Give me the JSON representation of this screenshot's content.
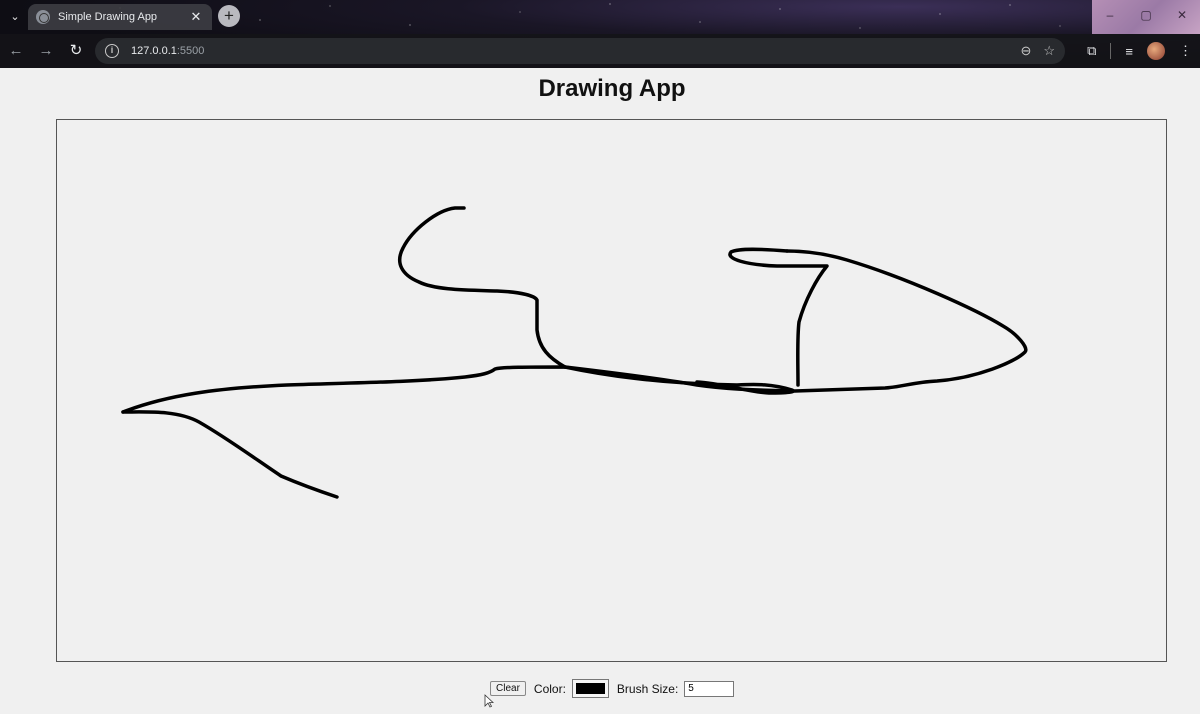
{
  "browser": {
    "tab_title": "Simple Drawing App",
    "tab_close": "✕",
    "new_tab": "+",
    "url_host": "127.0.0.1",
    "url_port": ":5500",
    "window_controls": [
      "–",
      "▢",
      "✕"
    ]
  },
  "page": {
    "title": "Drawing App"
  },
  "controls": {
    "clear_label": "Clear",
    "color_label": "Color:",
    "color_value": "#000000",
    "brush_size_label": "Brush Size:",
    "brush_size_value": "5"
  },
  "colors": {
    "stroke": "#000000",
    "page_background": "#f0f0f0"
  }
}
